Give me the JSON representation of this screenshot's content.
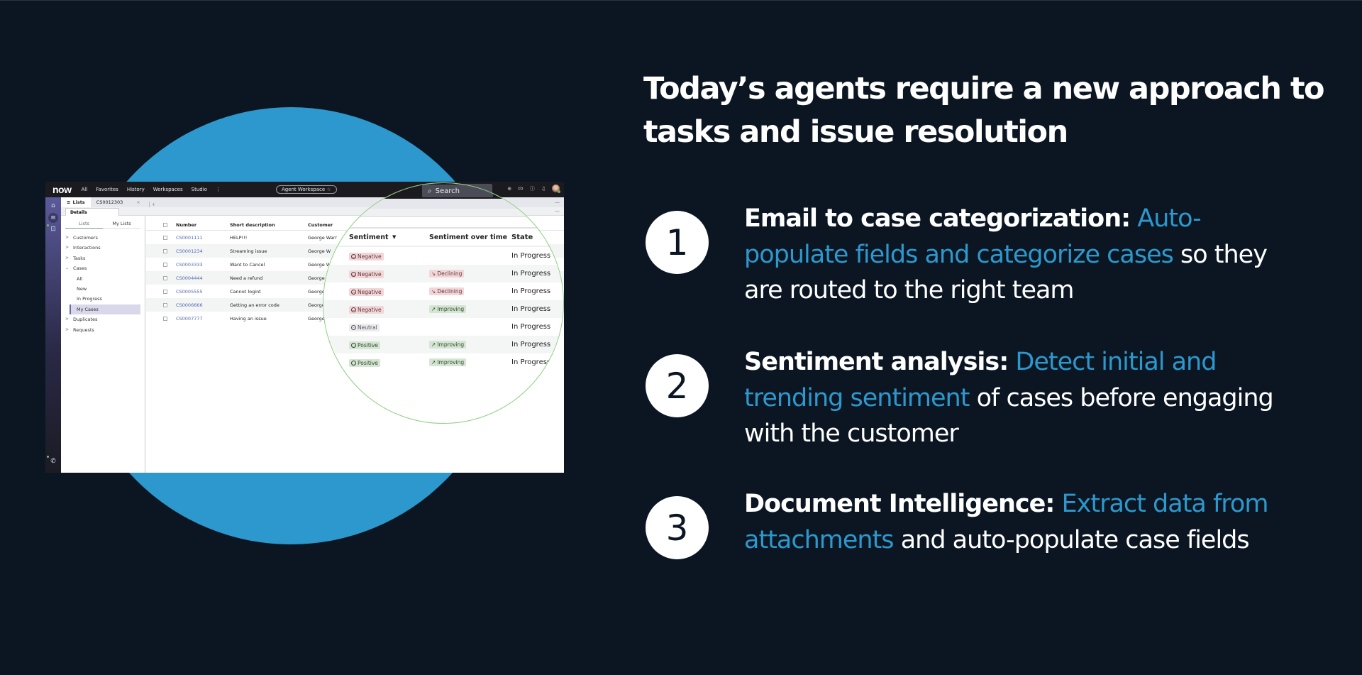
{
  "colors": {
    "background": "#0b1622",
    "accent_blue": "#2d98cd",
    "text_white": "#ffffff",
    "magnifier_ring": "#8fcf83"
  },
  "headline": "Today’s agents require a new approach to tasks and issue resolution",
  "points": [
    {
      "number": "1",
      "lead": "Email to case categorization:",
      "highlight": "Auto-populate fields and categorize cases",
      "rest": "so they are routed to the right team"
    },
    {
      "number": "2",
      "lead": "Sentiment analysis:",
      "highlight": "Detect initial and trending sentiment",
      "rest": "of cases before engaging with the customer"
    },
    {
      "number": "3",
      "lead": "Document Intelligence:",
      "highlight": "Extract data from attachments",
      "rest": "and auto-populate case fields"
    }
  ],
  "app": {
    "logo": "now",
    "nav": [
      "All",
      "Favorites",
      "History",
      "Workspaces",
      "Studio",
      "⋮"
    ],
    "workspace_pill": "Agent Workspace",
    "search_placeholder": "Search",
    "tabs": {
      "lists": "Lists",
      "record": "CS0012303"
    },
    "subtab": "Details",
    "left_panel": {
      "tabs": [
        "Lists",
        "My Lists"
      ],
      "tree": [
        {
          "label": "Customers",
          "expanded": false
        },
        {
          "label": "Interactions",
          "expanded": false
        },
        {
          "label": "Tasks",
          "expanded": false
        },
        {
          "label": "Cases",
          "expanded": true
        },
        {
          "label": "All",
          "sub": true
        },
        {
          "label": "New",
          "sub": true
        },
        {
          "label": "In Progress",
          "sub": true
        },
        {
          "label": "My Cases",
          "sub": true,
          "selected": true
        },
        {
          "label": "Duplicates",
          "expanded": false
        },
        {
          "label": "Requests",
          "expanded": false
        }
      ]
    },
    "list": {
      "columns": [
        "Number",
        "Short description",
        "Customer"
      ],
      "rows": [
        {
          "number": "CS0001111",
          "desc": "HELP!!!",
          "customer": "George Warr"
        },
        {
          "number": "CS0001234",
          "desc": "Streaming issue",
          "customer": "George W"
        },
        {
          "number": "CS0003333",
          "desc": "Want to Cancel",
          "customer": "George W"
        },
        {
          "number": "CS0004444",
          "desc": "Need a refund",
          "customer": "George"
        },
        {
          "number": "CS0005555",
          "desc": "Cannot logint",
          "customer": "George"
        },
        {
          "number": "CS0006666",
          "desc": "Getting an error code",
          "customer": "George"
        },
        {
          "number": "CS0007777",
          "desc": "Having an issue",
          "customer": "George"
        }
      ]
    },
    "magnified": {
      "columns": [
        "Sentiment",
        "Sentiment over time",
        "State"
      ],
      "rows": [
        {
          "sentiment": "Negative",
          "trend": "",
          "state": "In Progress"
        },
        {
          "sentiment": "Negative",
          "trend": "Declining",
          "state": "In Progress"
        },
        {
          "sentiment": "Negative",
          "trend": "Declining",
          "state": "In Progress"
        },
        {
          "sentiment": "Negative",
          "trend": "Improving",
          "state": "In Progress"
        },
        {
          "sentiment": "Neutral",
          "trend": "",
          "state": "In Progress"
        },
        {
          "sentiment": "Positive",
          "trend": "Improving",
          "state": "In Progress"
        },
        {
          "sentiment": "Positive",
          "trend": "Improving",
          "state": "In Progress"
        }
      ]
    }
  }
}
